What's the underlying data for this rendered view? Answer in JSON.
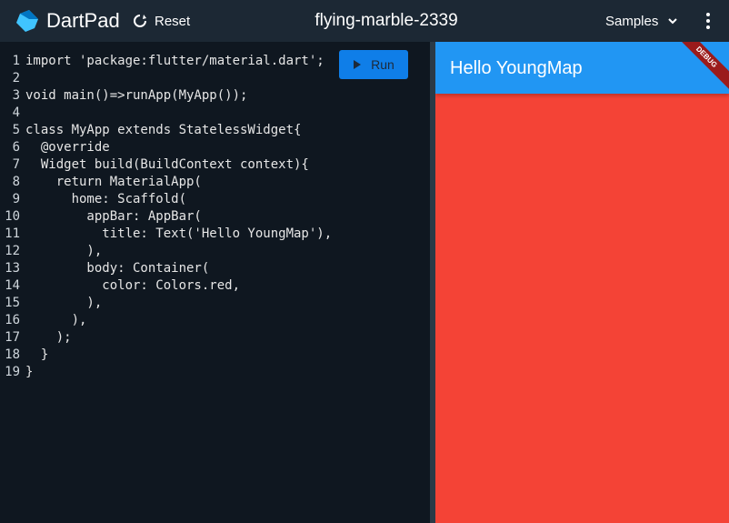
{
  "header": {
    "brand": "DartPad",
    "reset_label": "Reset",
    "title": "flying-marble-2339",
    "samples_label": "Samples"
  },
  "editor": {
    "run_label": "Run",
    "line_numbers": [
      "1",
      "2",
      "3",
      "4",
      "5",
      "6",
      "7",
      "8",
      "9",
      "10",
      "11",
      "12",
      "13",
      "14",
      "15",
      "16",
      "17",
      "18",
      "19"
    ],
    "lines": [
      "import 'package:flutter/material.dart';",
      "",
      "void main()=>runApp(MyApp());",
      "",
      "class MyApp extends StatelessWidget{",
      "  @override",
      "  Widget build(BuildContext context){",
      "    return MaterialApp(",
      "      home: Scaffold(",
      "        appBar: AppBar(",
      "          title: Text('Hello YoungMap'),",
      "        ),",
      "        body: Container(",
      "          color: Colors.red,",
      "        ),",
      "      ),",
      "    );",
      "  }",
      "}"
    ]
  },
  "preview": {
    "appbar_title": "Hello YoungMap",
    "debug_banner": "DEBUG",
    "colors": {
      "appbar": "#2196f3",
      "body": "#f44336"
    }
  },
  "colors": {
    "topbar": "#1c2834",
    "editor_bg": "#0f1720",
    "run_button": "#0f7ee8"
  }
}
